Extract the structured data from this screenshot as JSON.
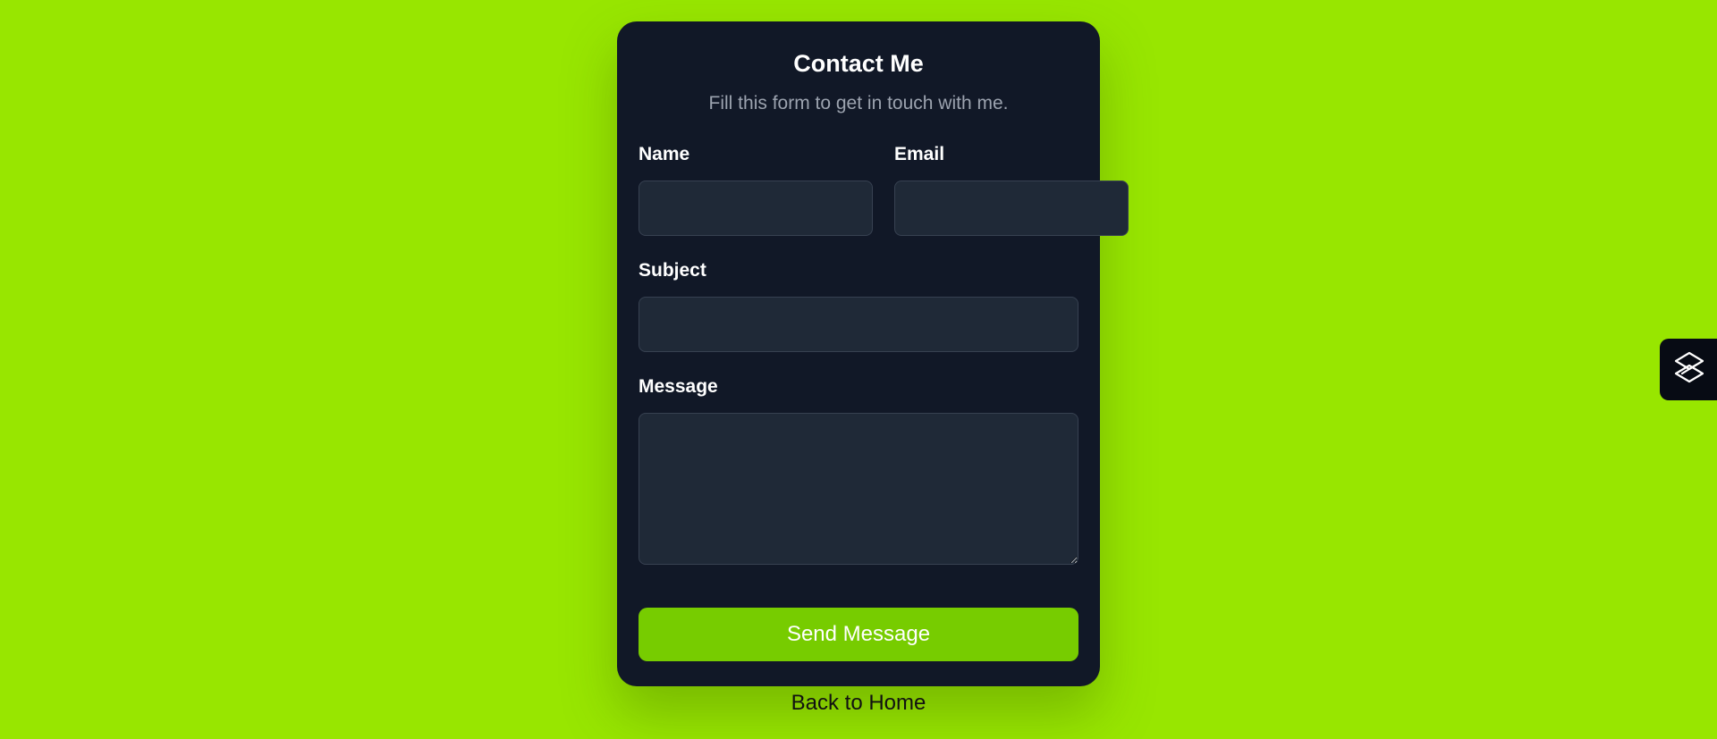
{
  "form": {
    "title": "Contact Me",
    "subtitle": "Fill this form to get in touch with me.",
    "name_label": "Name",
    "name_value": "",
    "email_label": "Email",
    "email_value": "",
    "subject_label": "Subject",
    "subject_value": "",
    "message_label": "Message",
    "message_value": "",
    "send_label": "Send Message"
  },
  "footer": {
    "back_label": "Back to Home"
  },
  "widget": {
    "icon": "layered-diamond-logo-icon"
  },
  "colors": {
    "page_background": "#98e600",
    "card_background": "#111827",
    "input_background": "#1f2937",
    "button_background": "#77cc00"
  }
}
